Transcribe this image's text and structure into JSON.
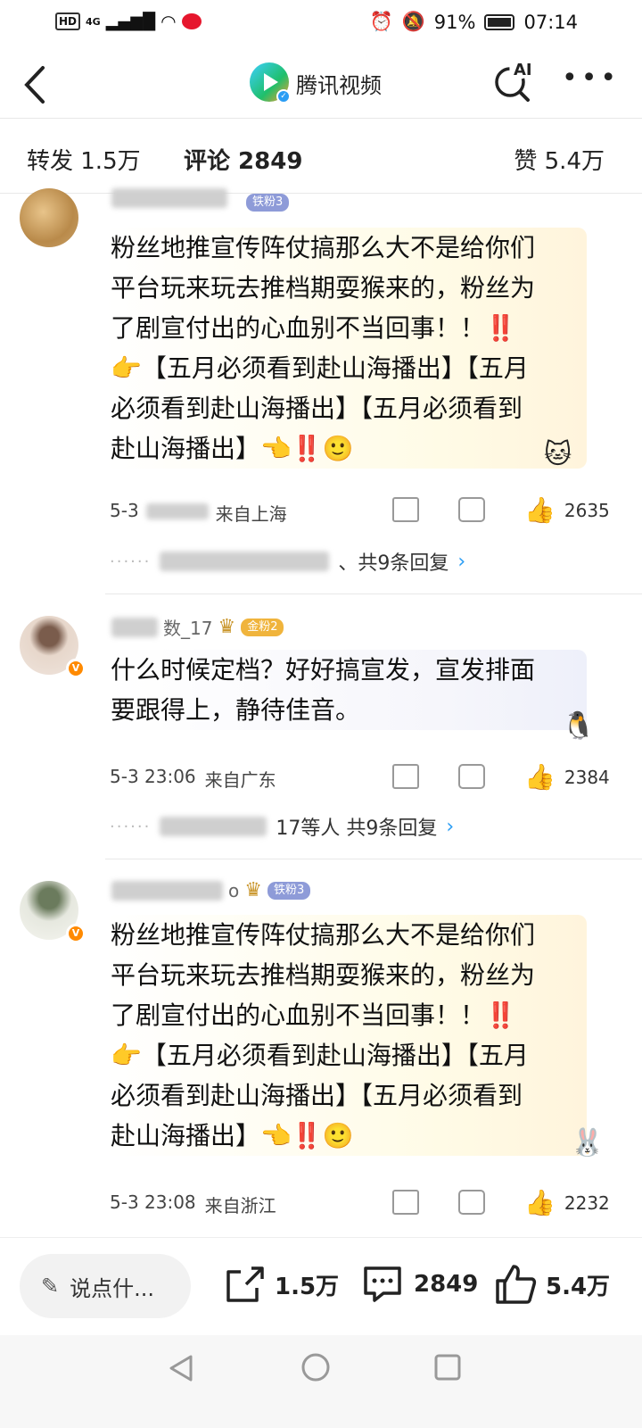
{
  "status_bar": {
    "signal": "4G",
    "battery": "91%",
    "time": "07:14"
  },
  "header": {
    "title": "腾讯视频",
    "ai_label": "AI"
  },
  "tabs": {
    "forward": "转发 1.5万",
    "comments": "评论 2849",
    "likes": "赞 5.4万"
  },
  "comments": [
    {
      "badge": "铁粉3",
      "text": "粉丝地推宣传阵仗搞那么大不是给你们平台玩来玩去推档期耍猴来的，粉丝为了剧宣付出的心血别不当回事！！‼️👉【五月必须看到赴山海播出】【五月必须看到赴山海播出】【五月必须看到赴山海播出】👈‼️🙂",
      "lines": [
        "粉丝地推宣传阵仗搞那么大不是给你们",
        "平台玩来玩去推档期耍猴来的，粉丝为",
        "了剧宣付出的心血别不当回事！！‼️",
        "👉【五月必须看到赴山海播出】【五月",
        "必须看到赴山海播出】【五月必须看到",
        "赴山海播出】👈‼️🙂"
      ],
      "time": "5-3",
      "location": "来自上海",
      "likes": "2635",
      "reply_text": "、共9条回复"
    },
    {
      "name": "数_17",
      "badge": "金粉2",
      "lines": [
        "什么时候定档？好好搞宣发，宣发排面",
        "要跟得上，静待佳音。"
      ],
      "time": "5-3 23:06",
      "location": "来自广东",
      "likes": "2384",
      "reply_text": "17等人  共9条回复"
    },
    {
      "name": "o",
      "badge": "铁粉3",
      "lines": [
        "粉丝地推宣传阵仗搞那么大不是给你们",
        "平台玩来玩去推档期耍猴来的，粉丝为",
        "了剧宣付出的心血别不当回事！！‼️",
        "👉【五月必须看到赴山海播出】【五月",
        "必须看到赴山海播出】【五月必须看到",
        "赴山海播出】👈‼️🙂"
      ],
      "time": "5-3 23:08",
      "location": "来自浙江",
      "likes": "2232"
    }
  ],
  "bottom_bar": {
    "input_placeholder": "说点什...",
    "forward": "1.5万",
    "comments": "2849",
    "likes": "5.4万"
  },
  "colors": {
    "accent_blue": "#2a9df4",
    "tie_badge": "#8e9bd8",
    "jin_badge": "#f0b43c",
    "v_mark": "#ff8a00"
  }
}
